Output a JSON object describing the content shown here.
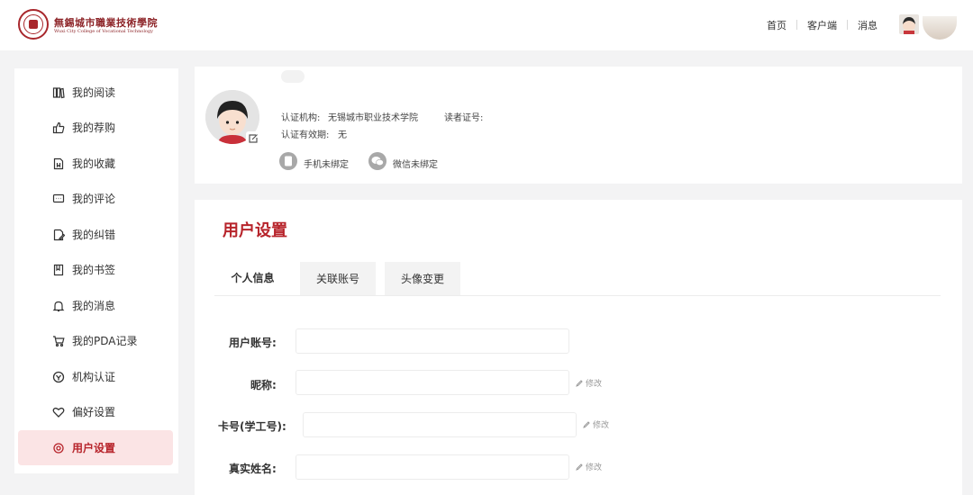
{
  "header": {
    "logo_text": "無錫城市職業技術學院",
    "logo_subtext": "Wuxi City College of Vocational Technology",
    "nav": [
      {
        "label": "首页"
      },
      {
        "label": "客户端"
      },
      {
        "label": "消息"
      }
    ]
  },
  "sidebar": {
    "items": [
      {
        "label": "我的阅读",
        "icon": "books-icon"
      },
      {
        "label": "我的荐购",
        "icon": "thumbs-up-icon"
      },
      {
        "label": "我的收藏",
        "icon": "bookmark-doc-icon"
      },
      {
        "label": "我的评论",
        "icon": "comment-icon"
      },
      {
        "label": "我的纠错",
        "icon": "edit-doc-icon"
      },
      {
        "label": "我的书签",
        "icon": "bookmark-icon"
      },
      {
        "label": "我的消息",
        "icon": "bell-icon"
      },
      {
        "label": "我的PDA记录",
        "icon": "cart-icon"
      },
      {
        "label": "机构认证",
        "icon": "verify-icon"
      },
      {
        "label": "偏好设置",
        "icon": "heart-icon"
      },
      {
        "label": "用户设置",
        "icon": "settings-icon",
        "active": true
      }
    ]
  },
  "profile": {
    "org_label": "认证机构:",
    "org_value": "无锡城市职业技术学院",
    "reader_id_label": "读者证号:",
    "validity_label": "认证有效期:",
    "validity_value": "无",
    "phone_status": "手机未绑定",
    "wechat_status": "微信未绑定"
  },
  "settings": {
    "title": "用户设置",
    "tabs": [
      {
        "label": "个人信息",
        "active": true
      },
      {
        "label": "关联账号"
      },
      {
        "label": "头像变更"
      }
    ],
    "fields": [
      {
        "label": "用户账号:",
        "value": "",
        "editable": false
      },
      {
        "label": "昵称:",
        "value": "",
        "editable": true,
        "edit_label": "修改"
      },
      {
        "label": "卡号(学工号):",
        "value": "",
        "editable": true,
        "edit_label": "修改"
      },
      {
        "label": "真实姓名:",
        "value": "",
        "editable": true,
        "edit_label": "修改"
      }
    ]
  },
  "colors": {
    "accent": "#b7242b",
    "active_bg": "#fbe4e5",
    "page_bg": "#f3f3f4"
  }
}
